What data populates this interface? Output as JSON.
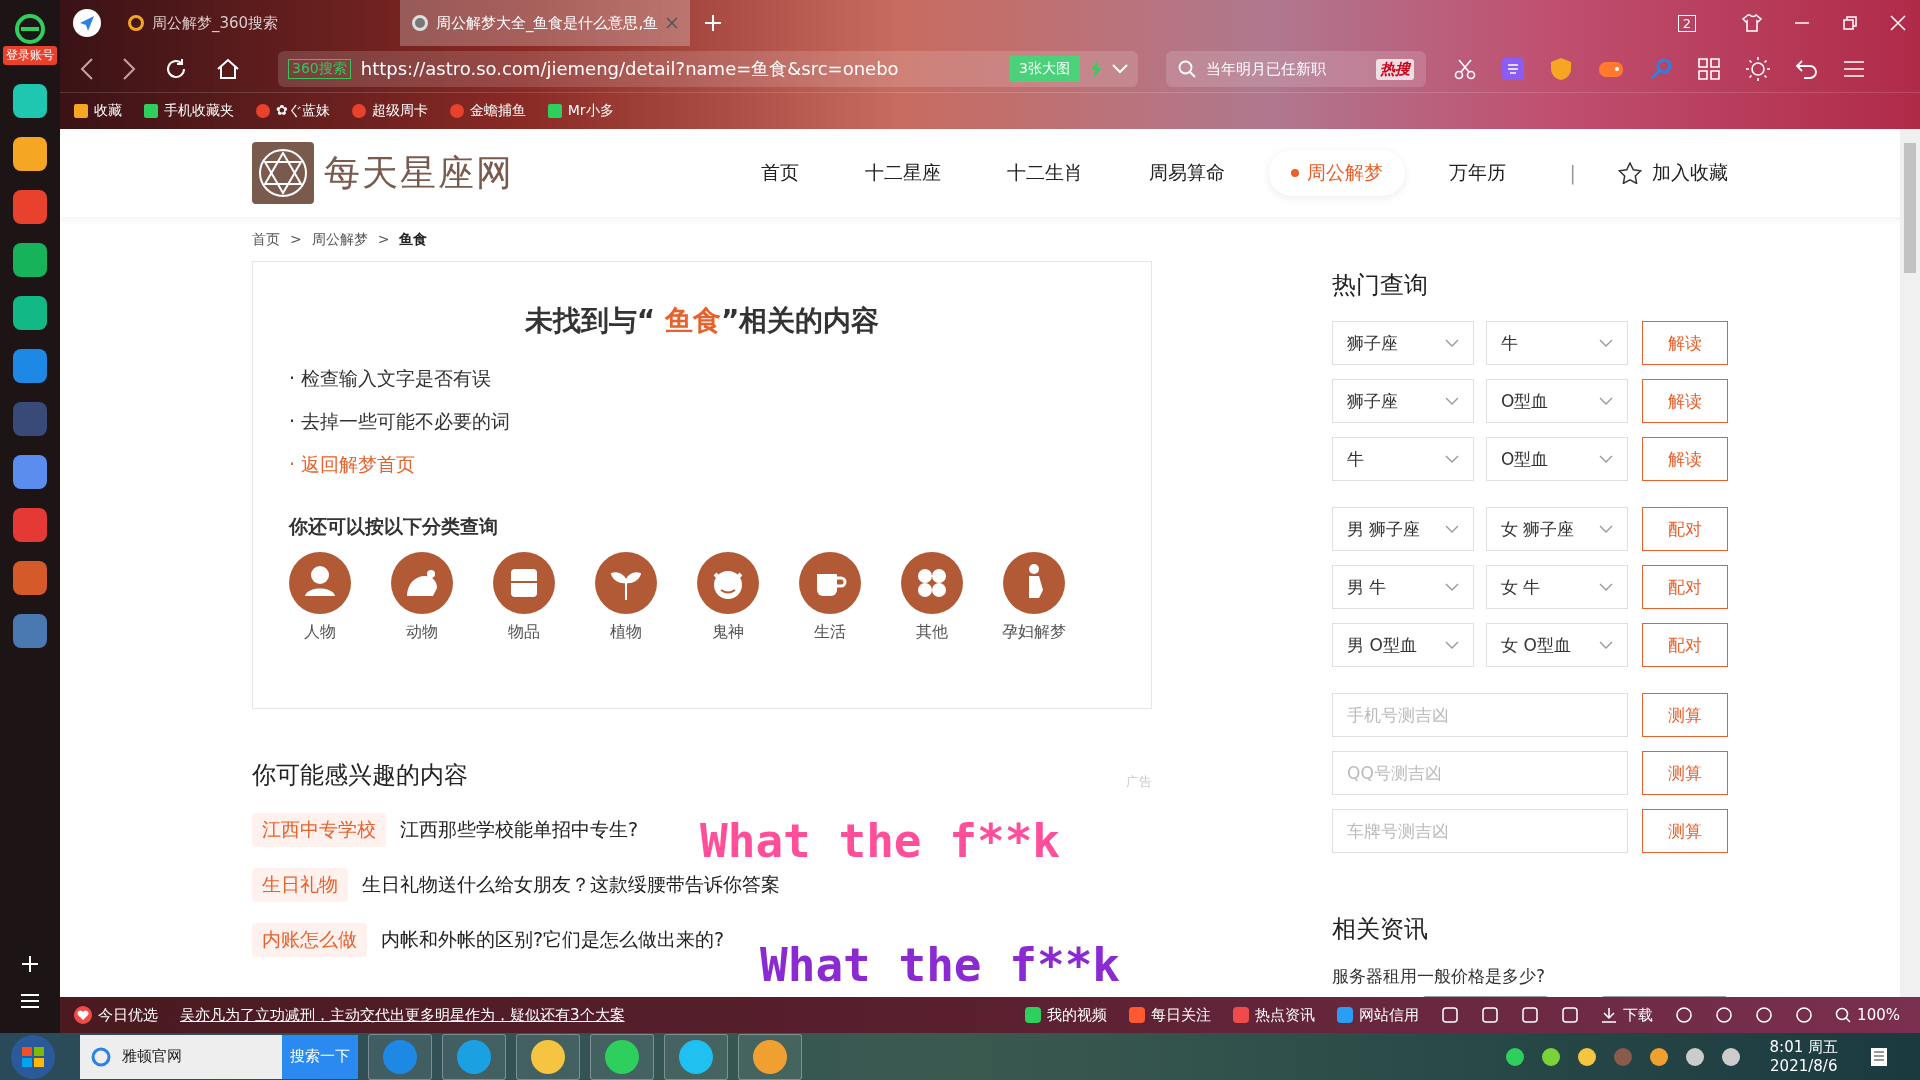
{
  "sidebar": {
    "login_badge": "登录账号"
  },
  "tabs": [
    {
      "title": "周公解梦_360搜索",
      "selected": false
    },
    {
      "title": "周公解梦大全_鱼食是什么意思,鱼",
      "selected": true
    }
  ],
  "window_controls": {
    "count_badge": "2"
  },
  "address_bar": {
    "site_label": "360搜索",
    "url": "https://astro.so.com/jiemeng/detail?name=鱼食&src=onebo",
    "image_button": "3张大图"
  },
  "search_box": {
    "value": "当年明月已任新职",
    "hot_label": "热搜"
  },
  "bookmarks": [
    "收藏",
    "手机收藏夹",
    "✿ぐ蓝妹",
    "超级周卡",
    "金蟾捕鱼",
    "Mr小多"
  ],
  "site": {
    "logo_text": "每天星座网",
    "nav": [
      {
        "label": "首页",
        "selected": false
      },
      {
        "label": "十二星座",
        "selected": false
      },
      {
        "label": "十二生肖",
        "selected": false
      },
      {
        "label": "周易算命",
        "selected": false
      },
      {
        "label": "周公解梦",
        "selected": true
      },
      {
        "label": "万年历",
        "selected": false
      }
    ],
    "nav_separator": "|",
    "favorite": "加入收藏"
  },
  "breadcrumb": {
    "items": [
      "首页",
      "周公解梦",
      "鱼食"
    ],
    "separators": [
      ">",
      ">"
    ]
  },
  "not_found": {
    "before": "未找到与“ ",
    "keyword": "鱼食",
    "after": "”相关的内容",
    "tips": [
      {
        "kind": "text",
        "text": "· 检查输入文字是否有误"
      },
      {
        "kind": "text",
        "text": "· 去掉一些可能不必要的词"
      },
      {
        "kind": "link",
        "text": "· 返回解梦首页"
      }
    ],
    "category_title": "你还可以按以下分类查询",
    "categories": [
      "人物",
      "动物",
      "物品",
      "植物",
      "鬼神",
      "生活",
      "其他",
      "孕妇解梦"
    ]
  },
  "interest": {
    "title": "你可能感兴趣的内容",
    "ad_label": "广告",
    "items": [
      {
        "tag": "江西中专学校",
        "text": "江西那些学校能单招中专生?"
      },
      {
        "tag": "生日礼物",
        "text": "生日礼物送什么给女朋友？这款绥腰带告诉你答案"
      },
      {
        "tag": "内账怎么做",
        "text": "内帐和外帐的区别?它们是怎么做出来的?"
      }
    ]
  },
  "hot_query": {
    "title": "热门查询",
    "rows": [
      {
        "kind": "select",
        "first": "狮子座",
        "second": "牛",
        "button": "解读"
      },
      {
        "kind": "select",
        "first": "狮子座",
        "second": "O型血",
        "button": "解读"
      },
      {
        "kind": "select",
        "first": "牛",
        "second": "O型血",
        "button": "解读"
      },
      {
        "kind": "select",
        "first": "男 狮子座",
        "second": "女 狮子座",
        "button": "配对"
      },
      {
        "kind": "select",
        "first": "男 牛",
        "second": "女 牛",
        "button": "配对"
      },
      {
        "kind": "select",
        "first": "男 O型血",
        "second": "女 O型血",
        "button": "配对"
      },
      {
        "kind": "input",
        "placeholder": "手机号测吉凶",
        "button": "测算"
      },
      {
        "kind": "input",
        "placeholder": "QQ号测吉凶",
        "button": "测算"
      },
      {
        "kind": "input",
        "placeholder": "车牌号测吉凶",
        "button": "测算"
      }
    ]
  },
  "news": {
    "title": "相关资讯",
    "items": [
      "服务器租用一般价格是多少?"
    ]
  },
  "overlays": [
    {
      "text": "What the f**k",
      "color": "#ff4f9a"
    },
    {
      "text": "What the f**k",
      "color": "#8a2ad0"
    }
  ],
  "status_bar": {
    "today": "今日优选",
    "headline": "吴亦凡为了立功减刑，主动交代出更多明星作为，疑似还有3个大案",
    "items": [
      "我的视频",
      "每日关注",
      "热点资讯",
      "网站信用"
    ],
    "download": "下载",
    "zoom": "100%"
  },
  "taskbar": {
    "search_value": "雅顿官网",
    "search_button": "搜索一下",
    "time": "8:01 周五",
    "date": "2021/8/6"
  }
}
